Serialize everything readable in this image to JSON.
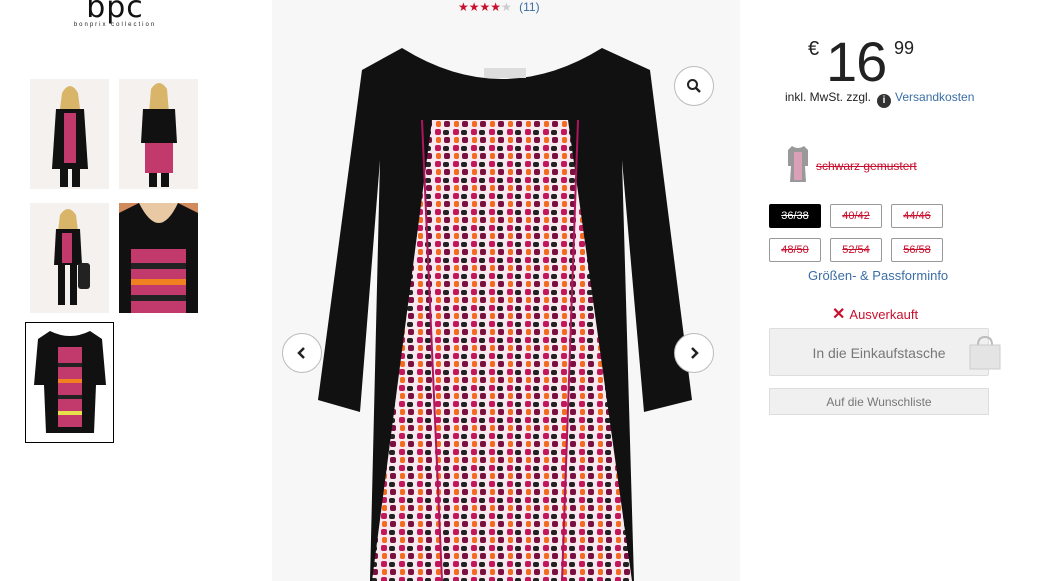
{
  "brand": {
    "logo": "bpc",
    "tagline": "bonprix collection"
  },
  "rating": {
    "stars_filled": 4,
    "stars_total": 5,
    "count_text": "(11)"
  },
  "icons": {
    "zoom": "magnifier-icon",
    "prev": "chevron-left-icon",
    "next": "chevron-right-icon",
    "info": "info-icon",
    "sold_out": "x-icon",
    "bag": "shopping-bag-icon"
  },
  "price": {
    "currency": "€",
    "whole": "16",
    "cents": "99",
    "tax_note": "inkl. MwSt. zzgl.",
    "shipping_link": "Versandkosten"
  },
  "color": {
    "label": "schwarz gemustert"
  },
  "sizes": [
    {
      "label": "36/38",
      "selected": true
    },
    {
      "label": "40/42",
      "selected": false
    },
    {
      "label": "44/46",
      "selected": false
    },
    {
      "label": "48/50",
      "selected": false
    },
    {
      "label": "52/54",
      "selected": false
    },
    {
      "label": "56/58",
      "selected": false
    }
  ],
  "fit_link": "Größen- & Passforminfo",
  "availability": "Ausverkauft",
  "buttons": {
    "cart": "In die Einkaufstasche",
    "wishlist": "Auf die Wunschliste"
  },
  "colors": {
    "accent_red": "#c8102e",
    "link_blue": "#3a6ea5"
  }
}
